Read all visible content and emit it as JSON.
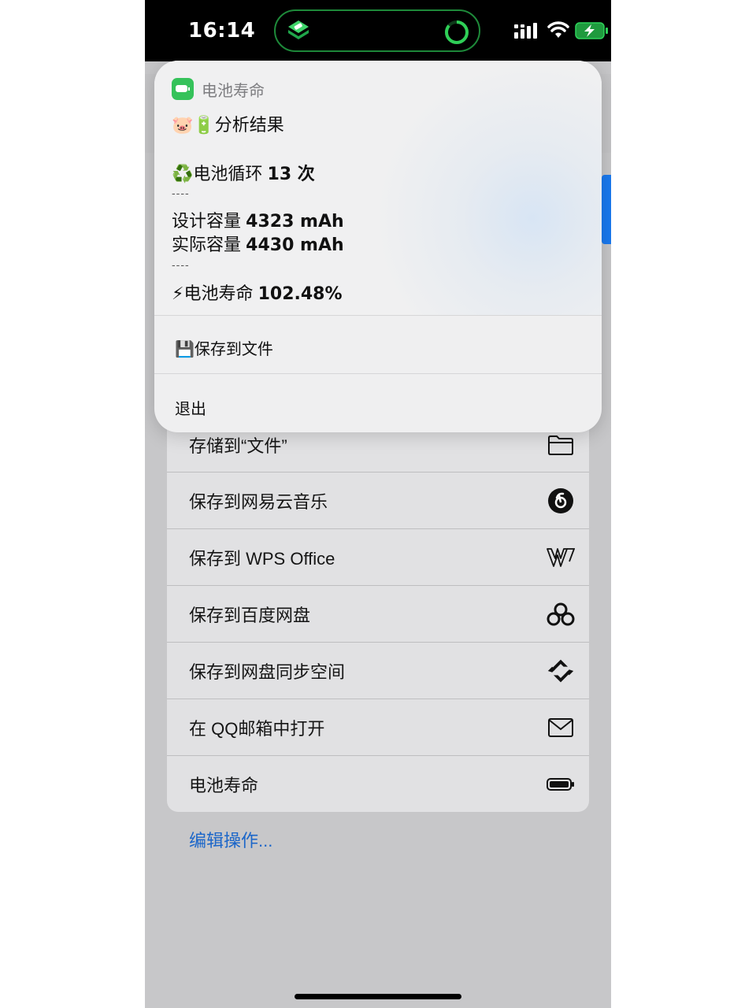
{
  "status_bar": {
    "time": "16:14",
    "island_app_icon": "shortcuts-icon",
    "island_activity_icon": "progress-ring-icon",
    "signal_icon": "cellular-signal-icon",
    "wifi_icon": "wifi-icon",
    "battery_icon": "battery-charging-icon",
    "accent_color": "#1e8a3a"
  },
  "popup": {
    "app_name": "电池寿命",
    "app_icon": "battery-app-icon",
    "app_icon_color": "#35c25a",
    "title": "🐷🔋分析结果",
    "cycle_label": "♻️电池循环",
    "cycle_value": "13 次",
    "separator_1": "----",
    "design_label": "设计容量",
    "design_value": "4323 mAh",
    "actual_label": "实际容量",
    "actual_value": "4430 mAh",
    "separator_2": "----",
    "health_label": "⚡电池寿命",
    "health_value": "102.48%",
    "save_button": "💾保存到文件",
    "exit_button": "退出"
  },
  "actions": [
    {
      "label": "存储到“文件”",
      "icon": "folder-icon"
    },
    {
      "label": "保存到网易云音乐",
      "icon": "netease-music-icon"
    },
    {
      "label": "保存到 WPS Office",
      "icon": "wps-office-icon"
    },
    {
      "label": "保存到百度网盘",
      "icon": "baidu-netdisk-icon"
    },
    {
      "label": "保存到网盘同步空间",
      "icon": "sync-space-icon"
    },
    {
      "label": "在 QQ邮箱中打开",
      "icon": "mail-icon"
    },
    {
      "label": "电池寿命",
      "icon": "battery-icon"
    }
  ],
  "edit_actions": "编辑操作...",
  "link_color": "#1b66c9"
}
